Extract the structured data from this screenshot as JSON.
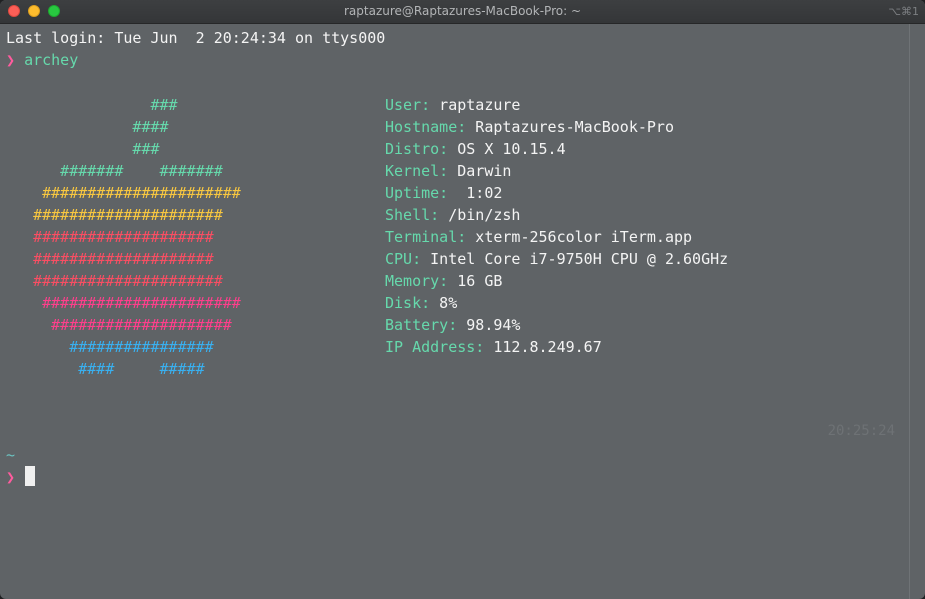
{
  "window": {
    "title": "raptazure@Raptazures-MacBook-Pro: ~",
    "shortcut": "⌥⌘1"
  },
  "colors": {
    "background": "#5f6366",
    "prompt_symbol": "#ff5c9e",
    "command": "#66d9ac",
    "art_green": "#66d9ac",
    "art_yellow": "#f8c740",
    "art_red": "#fa4e63",
    "art_pink": "#ff3f8c",
    "art_blue": "#39b0f0"
  },
  "terminal": {
    "last_login": "Last login: Tue Jun  2 20:24:34 on ttys000",
    "prompt_symbol": "❯",
    "command": "archey",
    "cwd": "~",
    "right_prompt": "20:25:24"
  },
  "archey_art": [
    {
      "text": "                ###",
      "color": "#66d9ac"
    },
    {
      "text": "              ####",
      "color": "#66d9ac"
    },
    {
      "text": "              ###",
      "color": "#66d9ac"
    },
    {
      "text": "      #######    #######",
      "color": "#66d9ac"
    },
    {
      "text": "    ######################",
      "color": "#f8c740"
    },
    {
      "text": "   #####################",
      "color": "#f8c740"
    },
    {
      "text": "   ####################",
      "color": "#fa4e63"
    },
    {
      "text": "   ####################",
      "color": "#fa4e63"
    },
    {
      "text": "   #####################",
      "color": "#fa4e63"
    },
    {
      "text": "    ######################",
      "color": "#ff3f8c"
    },
    {
      "text": "     ####################",
      "color": "#ff3f8c"
    },
    {
      "text": "       ################",
      "color": "#39b0f0"
    },
    {
      "text": "        ####     #####",
      "color": "#39b0f0"
    }
  ],
  "archey_info": [
    {
      "label": "User:",
      "value": " raptazure"
    },
    {
      "label": "Hostname:",
      "value": " Raptazures-MacBook-Pro"
    },
    {
      "label": "Distro:",
      "value": " OS X 10.15.4"
    },
    {
      "label": "Kernel:",
      "value": " Darwin"
    },
    {
      "label": "Uptime:",
      "value": "  1:02"
    },
    {
      "label": "Shell:",
      "value": " /bin/zsh"
    },
    {
      "label": "Terminal:",
      "value": " xterm-256color iTerm.app"
    },
    {
      "label": "CPU:",
      "value": " Intel Core i7-9750H CPU @ 2.60GHz"
    },
    {
      "label": "Memory:",
      "value": " 16 GB"
    },
    {
      "label": "Disk:",
      "value": " 8%"
    },
    {
      "label": "Battery:",
      "value": " 98.94%"
    },
    {
      "label": "IP Address:",
      "value": " 112.8.249.67"
    }
  ]
}
